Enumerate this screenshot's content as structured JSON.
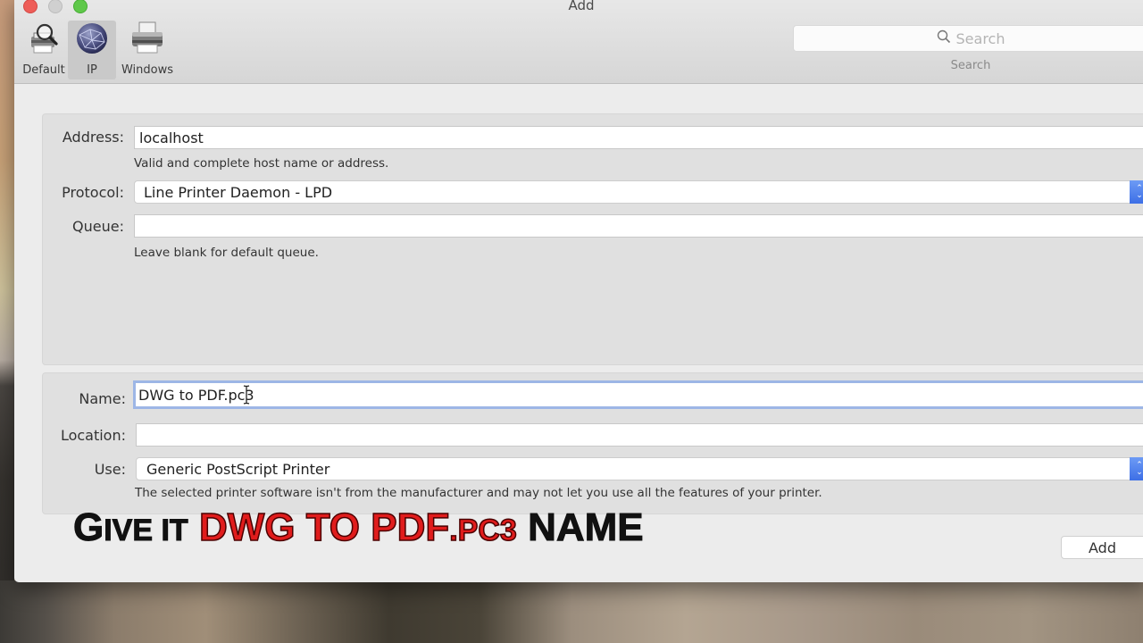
{
  "window": {
    "title": "Add"
  },
  "toolbar": {
    "items": [
      {
        "label": "Default",
        "icon": "printer-search-icon",
        "active": false
      },
      {
        "label": "IP",
        "icon": "globe-network-icon",
        "active": true
      },
      {
        "label": "Windows",
        "icon": "printer-icon",
        "active": false
      }
    ]
  },
  "search": {
    "placeholder": "Search",
    "caption": "Search",
    "icon": "search-icon"
  },
  "connection": {
    "address": {
      "label": "Address:",
      "value": "localhost",
      "hint": "Valid and complete host name or address."
    },
    "protocol": {
      "label": "Protocol:",
      "value": "Line Printer Daemon - LPD"
    },
    "queue": {
      "label": "Queue:",
      "value": "",
      "hint": "Leave blank for default queue."
    }
  },
  "printer": {
    "name": {
      "label": "Name:",
      "value": "DWG to PDF.pc3"
    },
    "location": {
      "label": "Location:",
      "value": ""
    },
    "use": {
      "label": "Use:",
      "value": "Generic PostScript Printer",
      "hint": "The selected printer software isn't from the manufacturer and may not let you use all the features of your printer."
    }
  },
  "overlay_caption": {
    "part1_big": "G",
    "part1_small": "IVE IT",
    "part2": "DWG TO PDF",
    "part3": ".PC3",
    "part4": "NAME"
  },
  "buttons": {
    "add": "Add"
  },
  "colors": {
    "accent": "#3d6fe6",
    "focus_ring": "#9db6e6",
    "caption_red": "#e01c1c"
  }
}
